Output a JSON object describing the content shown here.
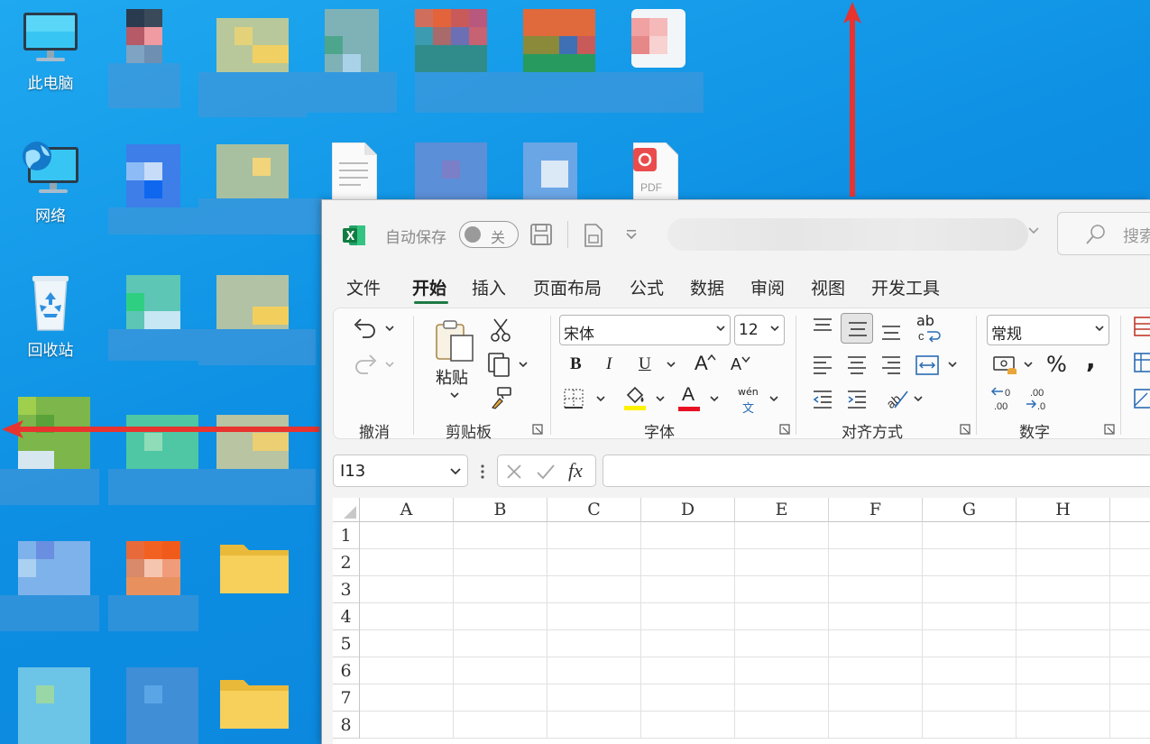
{
  "desktop": {
    "this_pc": "此电脑",
    "network": "网络",
    "recycle_bin": "回收站",
    "pdf_badge": "PDF"
  },
  "excel": {
    "autosave_label": "自动保存",
    "autosave_state": "关",
    "search_placeholder": "搜索",
    "tabs": [
      "文件",
      "开始",
      "插入",
      "页面布局",
      "公式",
      "数据",
      "审阅",
      "视图",
      "开发工具"
    ],
    "active_tab": "开始",
    "ribbon": {
      "undo_group": "撤消",
      "clipboard_group": "剪贴板",
      "paste": "粘贴",
      "font_group": "字体",
      "font_name": "宋体",
      "font_size": "12",
      "bold": "B",
      "italic": "I",
      "underline": "U",
      "grow_font": "A",
      "shrink_font": "A",
      "font_color": "A",
      "phonetic_top": "wén",
      "phonetic_bottom": "文",
      "align_group": "对齐方式",
      "wrap_label": "ab",
      "number_group": "数字",
      "number_format": "常规",
      "percent": "%",
      "comma": ","
    },
    "name_box": "I13",
    "fx_label": "fx",
    "columns": [
      "A",
      "B",
      "C",
      "D",
      "E",
      "F",
      "G",
      "H"
    ],
    "rows": [
      "1",
      "2",
      "3",
      "4",
      "5",
      "6",
      "7",
      "8"
    ]
  },
  "colors": {
    "desktop_blue": "#0d8fe3",
    "excel_green": "#1d7a44",
    "arrow_red": "#e8332e"
  }
}
